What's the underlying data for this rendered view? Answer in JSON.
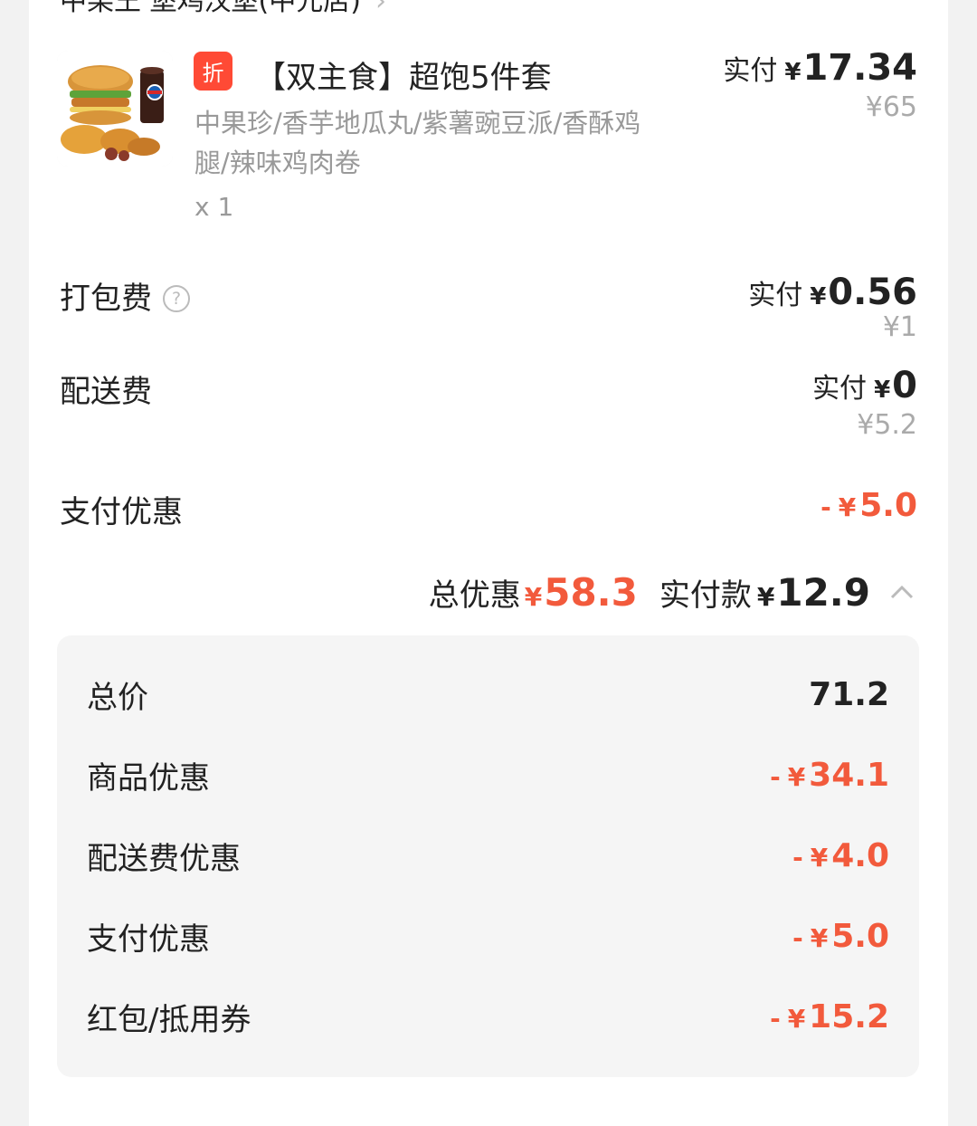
{
  "header": {
    "store_partial": "中某王  堡鸡汉堡(中元店)"
  },
  "product": {
    "badge": "折",
    "title": "【双主食】超饱5件套",
    "desc": "中果珍/香芋地瓜丸/紫薯豌豆派/香酥鸡腿/辣味鸡肉卷",
    "qty": "x 1",
    "paid_label": "实付",
    "paid_currency": "¥",
    "paid_value": "17.34",
    "original": "¥65"
  },
  "packing": {
    "label": "打包费",
    "help": "?",
    "paid_label": "实付",
    "paid_currency": "¥",
    "paid_value": "0.56",
    "original": "¥1"
  },
  "delivery": {
    "label": "配送费",
    "paid_label": "实付",
    "paid_currency": "¥",
    "paid_value": "0",
    "original": "¥5.2"
  },
  "payment_discount": {
    "label": "支付优惠",
    "sign": "-",
    "currency": "¥",
    "value": "5.0"
  },
  "summary": {
    "total_discount_label": "总优惠",
    "total_discount_currency": "¥",
    "total_discount_value": "58.3",
    "actual_label": "实付款",
    "actual_currency": "¥",
    "actual_value": "12.9"
  },
  "breakdown": {
    "total_label": "总价",
    "total_value": "71.2",
    "items": [
      {
        "label": "商品优惠",
        "sign": "-",
        "currency": "¥",
        "value": "34.1"
      },
      {
        "label": "配送费优惠",
        "sign": "-",
        "currency": "¥",
        "value": "4.0"
      },
      {
        "label": "支付优惠",
        "sign": "-",
        "currency": "¥",
        "value": "5.0"
      },
      {
        "label": "红包/抵用券",
        "sign": "-",
        "currency": "¥",
        "value": "15.2"
      }
    ]
  },
  "colors": {
    "accent": "#f25a3c",
    "badge": "#ff4a35",
    "muted": "#999999",
    "panel": "#f5f5f5"
  }
}
